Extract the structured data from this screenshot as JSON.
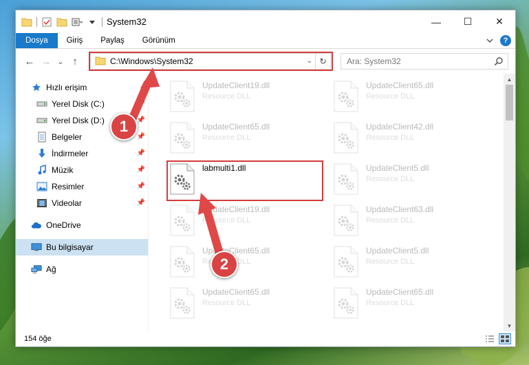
{
  "window": {
    "title": "System32",
    "minimize_glyph": "—",
    "maximize_glyph": "☐",
    "close_glyph": "✕"
  },
  "ribbon": {
    "tabs": [
      "Dosya",
      "Giriş",
      "Paylaş",
      "Görünüm"
    ],
    "active_tab": "Dosya",
    "help_glyph": "?"
  },
  "nav": {
    "back_glyph": "←",
    "forward_glyph": "→",
    "recent_glyph": "⌄",
    "up_glyph": "↑",
    "address": "C:\\Windows\\System32",
    "address_dropdown_glyph": "⌄",
    "refresh_glyph": "↻",
    "search_placeholder": "Ara: System32"
  },
  "sidebar": {
    "quick_access": "Hızlı erişim",
    "items": [
      {
        "label": "Yerel Disk (C:)",
        "icon": "drive-icon",
        "pinned": true
      },
      {
        "label": "Yerel Disk (D:)",
        "icon": "drive-icon",
        "pinned": true
      },
      {
        "label": "Belgeler",
        "icon": "documents-icon",
        "pinned": true
      },
      {
        "label": "İndirmeler",
        "icon": "downloads-icon",
        "pinned": true
      },
      {
        "label": "Müzik",
        "icon": "music-icon",
        "pinned": true
      },
      {
        "label": "Resimler",
        "icon": "pictures-icon",
        "pinned": true
      },
      {
        "label": "Videolar",
        "icon": "videos-icon",
        "pinned": true
      }
    ],
    "onedrive": "OneDrive",
    "this_pc": "Bu bilgisayar",
    "network": "Ağ"
  },
  "files": [
    {
      "name": "UpdateClient19.dll",
      "type": "Resource DLL",
      "faded": true
    },
    {
      "name": "UpdateClient65.dll",
      "type": "Resource DLL",
      "faded": true
    },
    {
      "name": "UpdateClient65.dll",
      "type": "Resource DLL",
      "faded": true
    },
    {
      "name": "UpdateClient42.dll",
      "type": "Resource DLL",
      "faded": true
    },
    {
      "name": "labmulti1.dll",
      "type": "",
      "faded": false
    },
    {
      "name": "UpdateClient5.dll",
      "type": "Resource DLL",
      "faded": true
    },
    {
      "name": "UpdateClient19.dll",
      "type": "Resource DLL",
      "faded": true
    },
    {
      "name": "UpdateClient63.dll",
      "type": "Resource DLL",
      "faded": true
    },
    {
      "name": "UpdateClient65.dll",
      "type": "Resource DLL",
      "faded": true
    },
    {
      "name": "UpdateClient5.dll",
      "type": "Resource DLL",
      "faded": true
    },
    {
      "name": "UpdateClient65.dll",
      "type": "Resource DLL",
      "faded": true
    },
    {
      "name": "UpdateClient65.dll",
      "type": "Resource DLL",
      "faded": true
    }
  ],
  "status": {
    "count": "154 öğe"
  },
  "badges": {
    "step1": "1",
    "step2": "2"
  },
  "colors": {
    "accent": "#1979ca",
    "highlight": "#d63a3a",
    "selected": "#cce1f2"
  }
}
